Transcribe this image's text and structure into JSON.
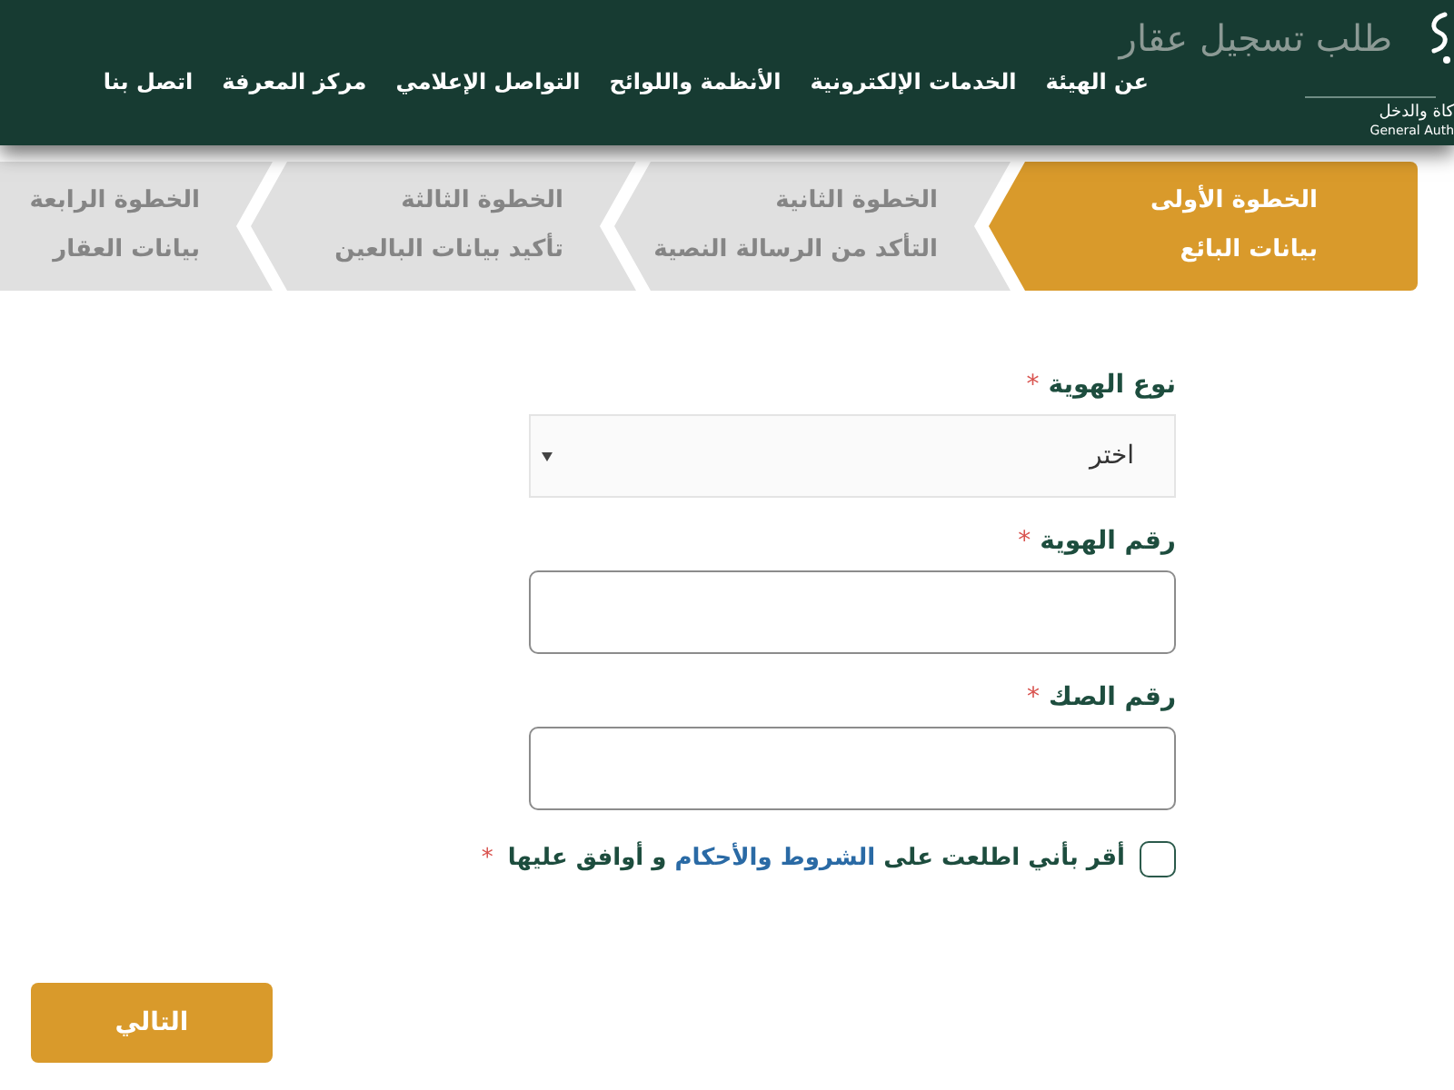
{
  "header": {
    "title": "طلب تسجيل عقار",
    "logo": {
      "name_ar": "كاة والدخل",
      "name_en": "General Auth"
    },
    "nav": [
      "عن الهيئة",
      "الخدمات الإلكترونية",
      "الأنظمة واللوائح",
      "التواصل الإعلامي",
      "مركز المعرفة",
      "اتصل بنا"
    ]
  },
  "steps": [
    {
      "title": "الخطوة الأولى",
      "subtitle": "بيانات البائع",
      "selected": true
    },
    {
      "title": "الخطوة الثانية",
      "subtitle": "التأكد من الرسالة النصية",
      "selected": false
    },
    {
      "title": "الخطوة الثالثة",
      "subtitle": "تأكيد بيانات البالعين",
      "selected": false
    },
    {
      "title": "الخطوة الرابعة",
      "subtitle": "بيانات العقار",
      "selected": false
    }
  ],
  "form": {
    "fields": [
      {
        "kind": "select",
        "label": "نوع الهوية",
        "required_mark": "*",
        "value": "اختر"
      },
      {
        "kind": "text",
        "label": "رقم الهوية",
        "required_mark": "*"
      },
      {
        "kind": "text",
        "label": "رقم الصك",
        "required_mark": "*"
      }
    ],
    "agreement": {
      "checked": false,
      "text": "أقر بأني اطلعت على",
      "link": "الشروط والأحكام",
      "text_end": "و أوافق عليها",
      "required_mark": "*"
    }
  },
  "next_button": "التالي"
}
